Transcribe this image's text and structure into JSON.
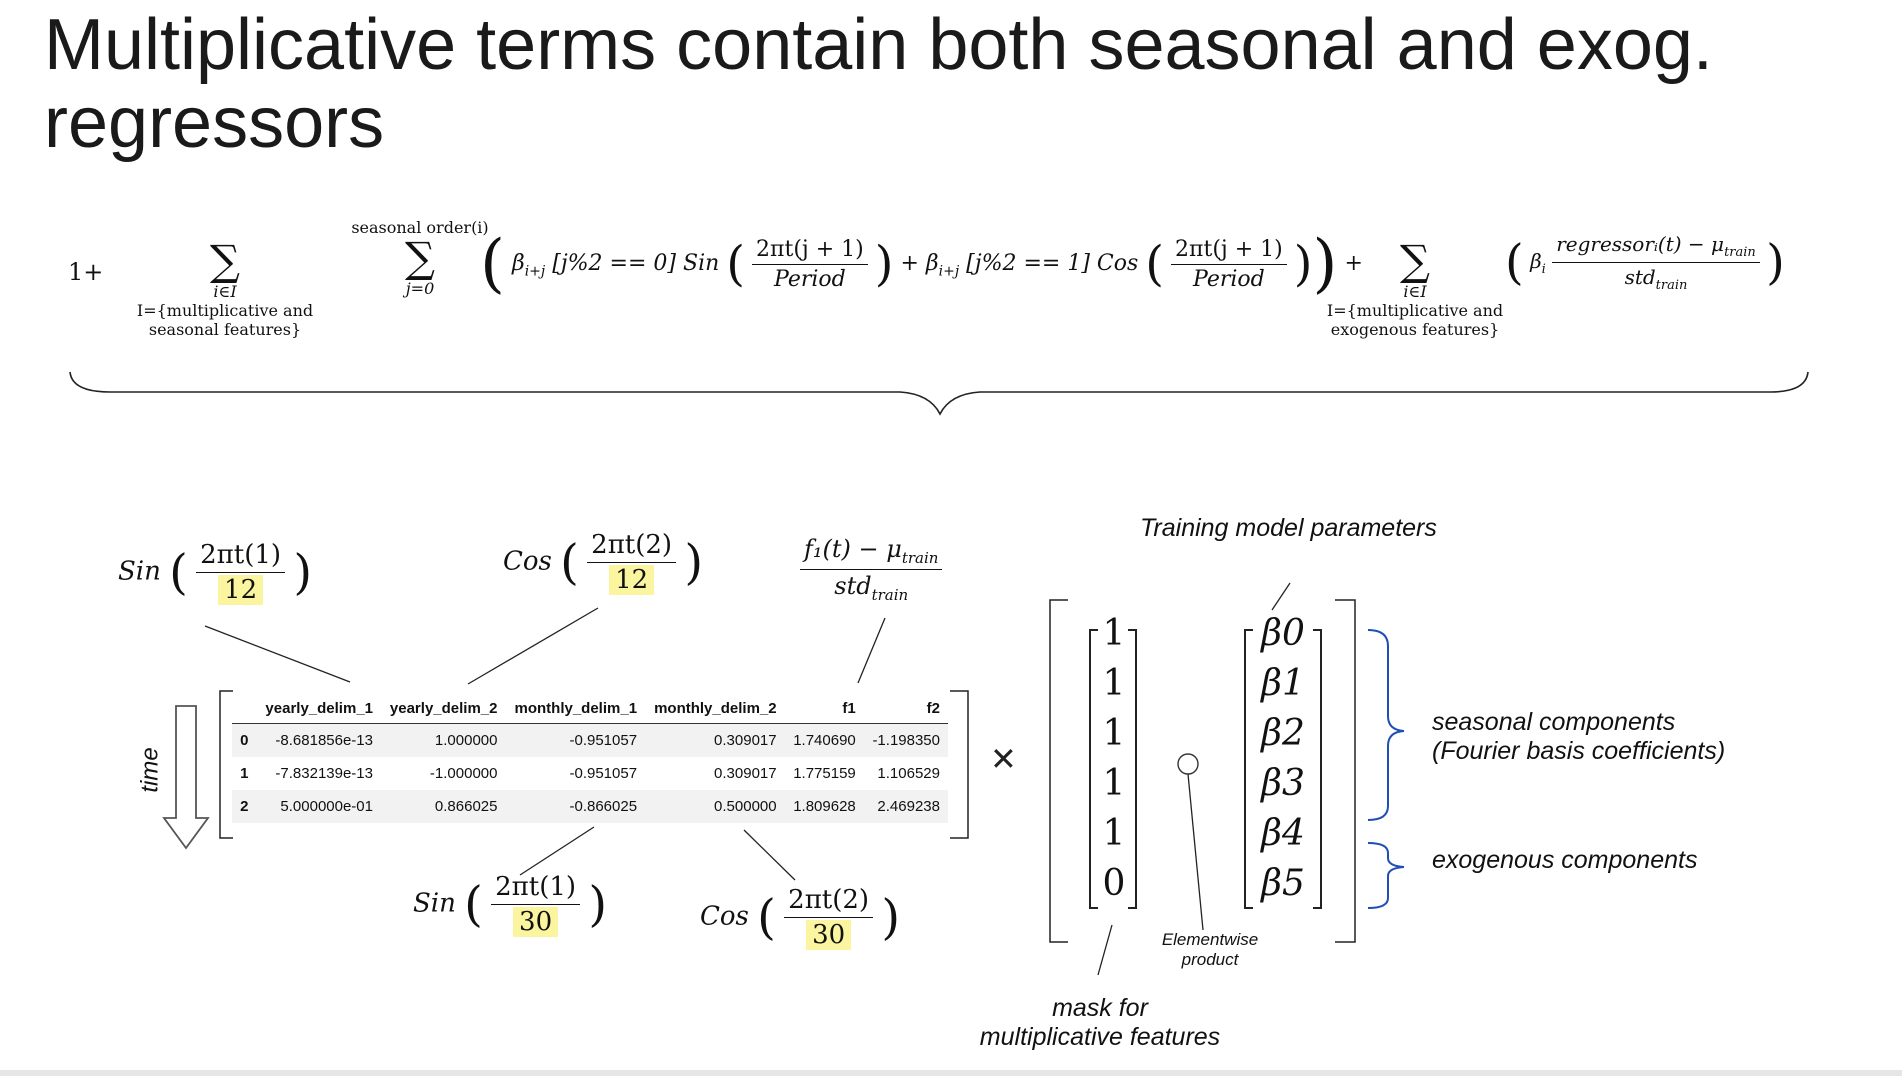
{
  "title": "Multiplicative terms contain both seasonal and exog. regressors",
  "formula": {
    "lead": "1+",
    "sum1_index": "i∈I",
    "sum1_set_line1": "I={multiplicative and",
    "sum1_set_line2": "seasonal features}",
    "sum2_top": "seasonal order(i)",
    "sum2_index": "j=0",
    "term_sin_coef": "β",
    "term_sin_sub": "i+j",
    "term_sin_cond": "[j%2 == 0]",
    "term_sin_name": "Sin",
    "term_num": "2πt(j + 1)",
    "term_den": "Period",
    "plus": "+",
    "term_cos_coef": "β",
    "term_cos_sub": "i+j",
    "term_cos_cond": "[j%2 == 1]",
    "term_cos_name": "Cos",
    "plus2": "+",
    "sum3_index": "i∈I",
    "sum3_set_line1": "I={multiplicative and",
    "sum3_set_line2": "exogenous features}",
    "reg_coef": "β",
    "reg_sub": "i",
    "reg_num": "regressorᵢ(t) − μ",
    "reg_num_sub": "train",
    "reg_den": "std",
    "reg_den_sub": "train"
  },
  "annotations": {
    "sin12": {
      "fn": "Sin",
      "num": "2πt(1)",
      "den": "12"
    },
    "cos12": {
      "fn": "Cos",
      "num": "2πt(2)",
      "den": "12"
    },
    "f1norm": {
      "num": "f₁(t) − μ",
      "num_sub": "train",
      "den": "std",
      "den_sub": "train"
    },
    "sin30": {
      "fn": "Sin",
      "num": "2πt(1)",
      "den": "30"
    },
    "cos30": {
      "fn": "Cos",
      "num": "2πt(2)",
      "den": "30"
    }
  },
  "time_label": "time",
  "table": {
    "columns": [
      "",
      "yearly_delim_1",
      "yearly_delim_2",
      "monthly_delim_1",
      "monthly_delim_2",
      "f1",
      "f2"
    ],
    "rows": [
      [
        "0",
        "-8.681856e-13",
        "1.000000",
        "-0.951057",
        "0.309017",
        "1.740690",
        "-1.198350"
      ],
      [
        "1",
        "-7.832139e-13",
        "-1.000000",
        "-0.951057",
        "0.309017",
        "1.775159",
        "1.106529"
      ],
      [
        "2",
        "5.000000e-01",
        "0.866025",
        "-0.866025",
        "0.500000",
        "1.809628",
        "2.469238"
      ]
    ]
  },
  "times_symbol": "✕",
  "mask_vector": [
    "1",
    "1",
    "1",
    "1",
    "1",
    "0"
  ],
  "beta_vector": [
    "β0",
    "β1",
    "β2",
    "β3",
    "β4",
    "β5"
  ],
  "labels": {
    "training_params": "Training model parameters",
    "elementwise_line1": "Elementwise",
    "elementwise_line2": "product",
    "mask_line1": "mask for",
    "mask_line2": "multiplicative features",
    "seasonal_line1": "seasonal components",
    "seasonal_line2": "(Fourier basis coefficients)",
    "exogenous": "exogenous components"
  },
  "colors": {
    "highlight": "#fbf5a0",
    "brace_blue": "#1f4fb5"
  }
}
